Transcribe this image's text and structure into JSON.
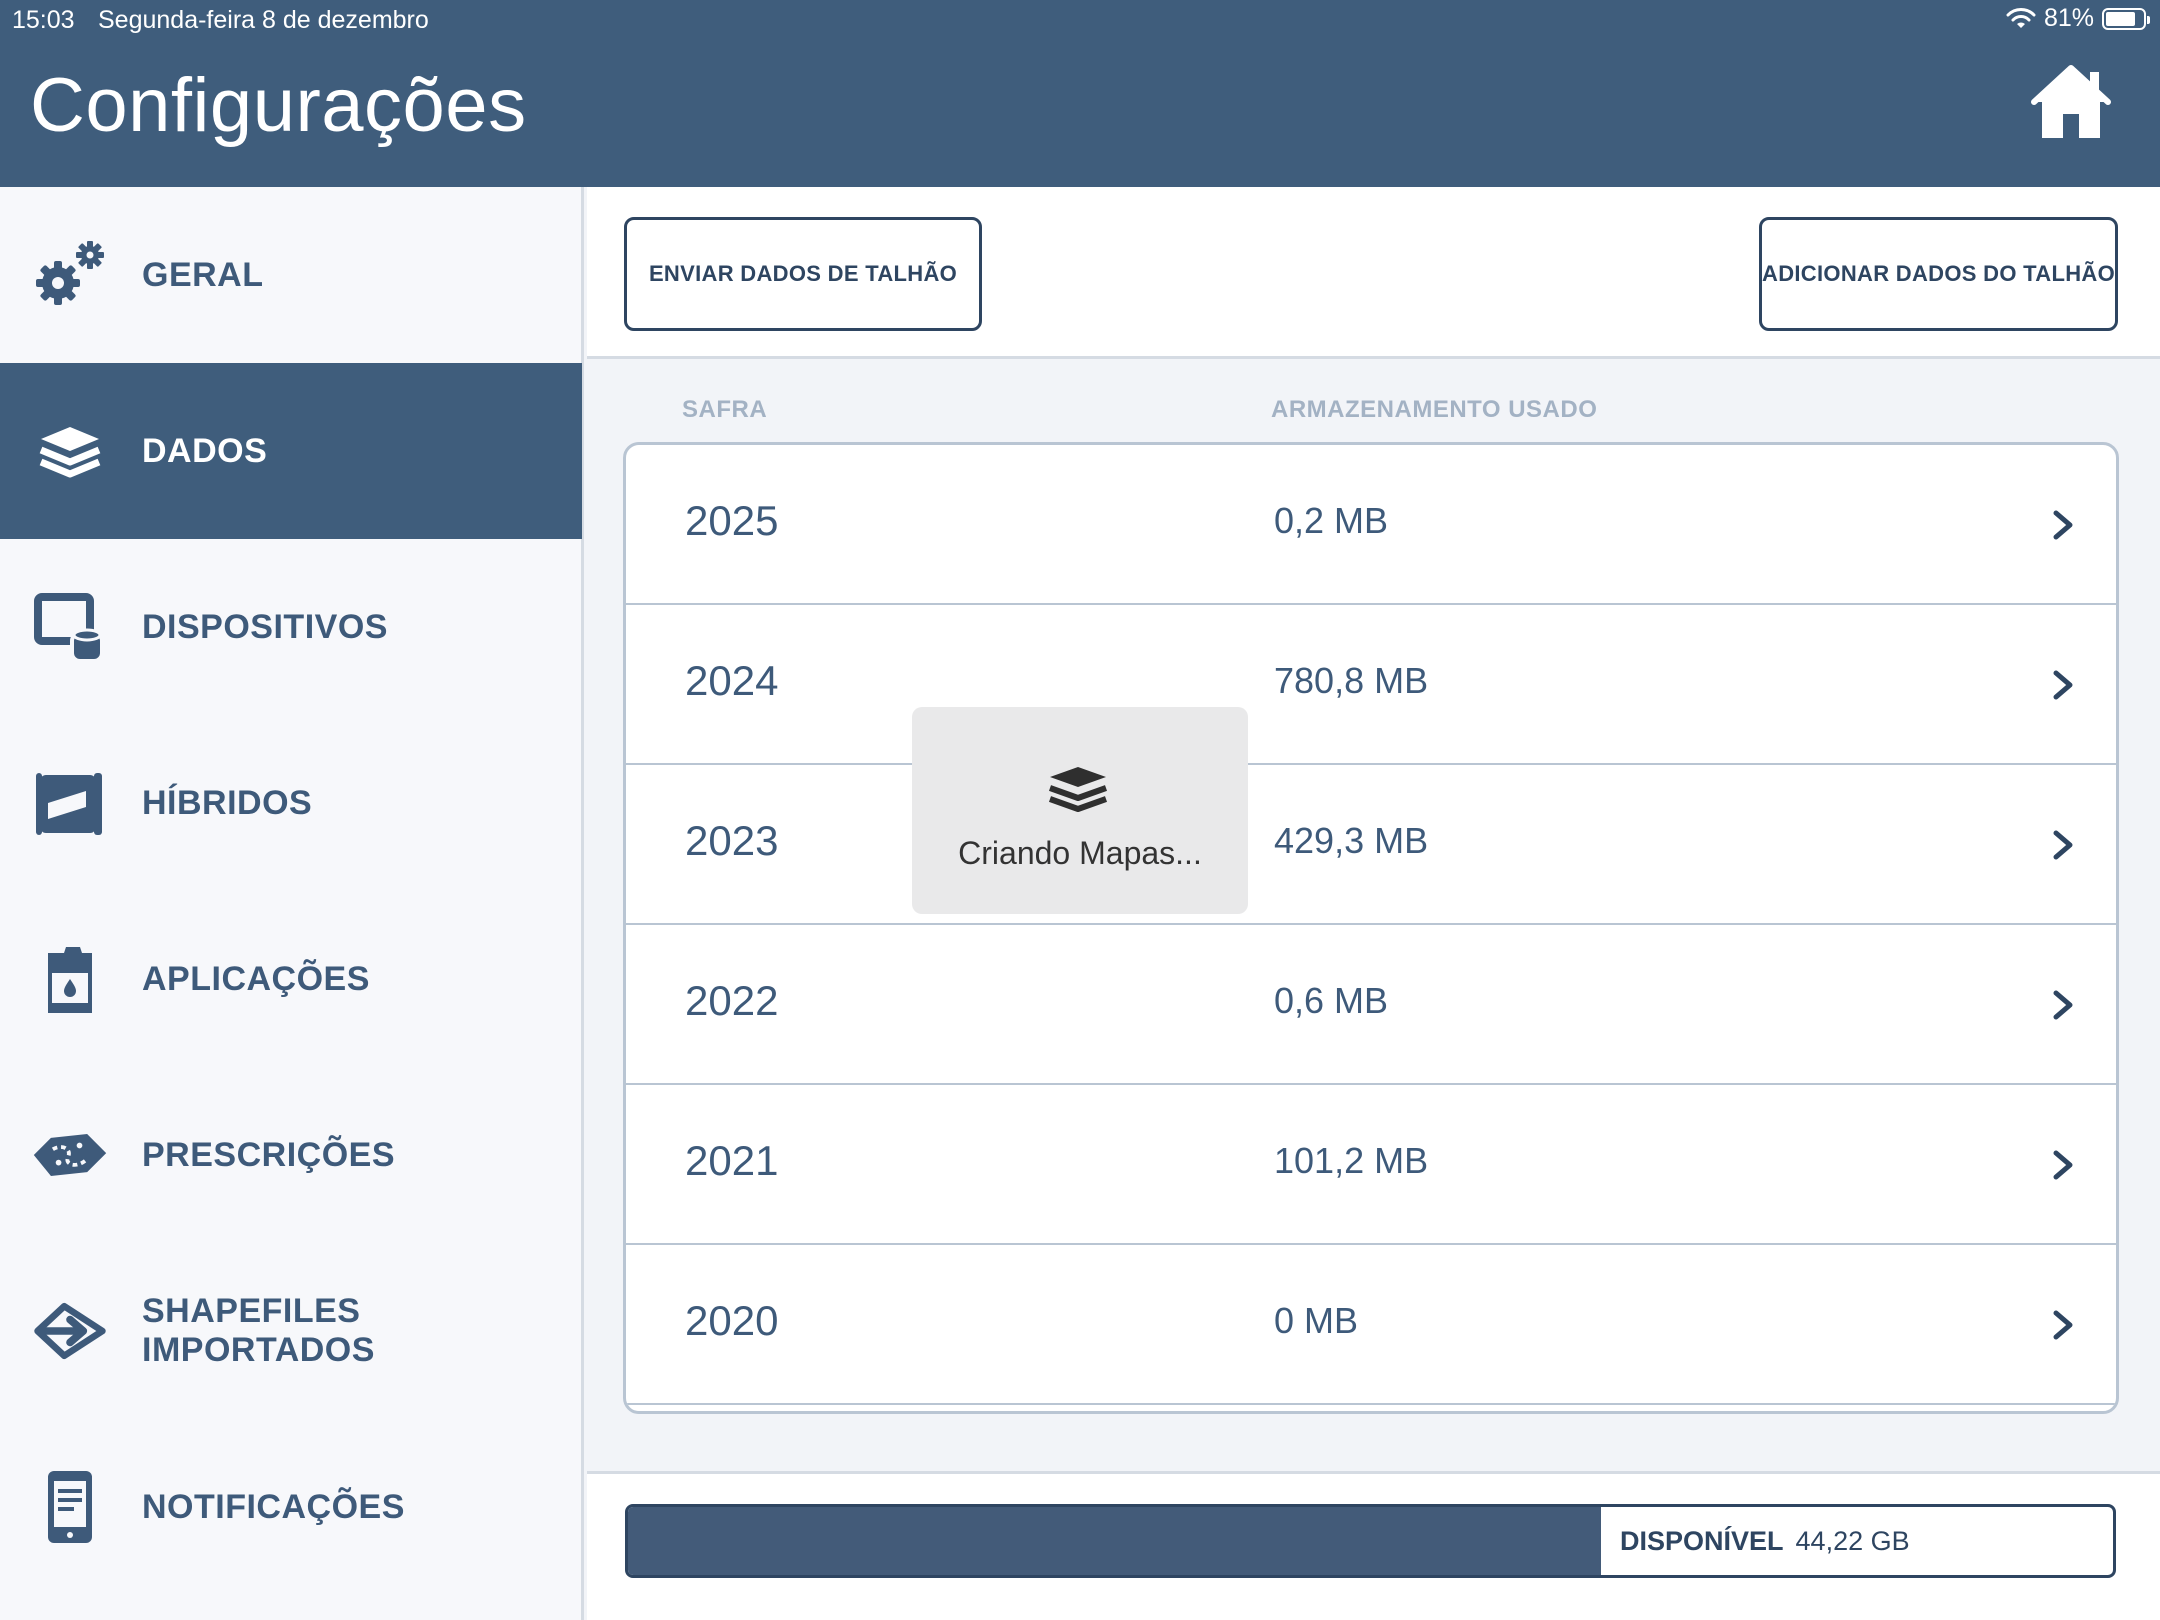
{
  "status": {
    "time": "15:03",
    "date": "Segunda-feira 8 de dezembro",
    "battery": "81%",
    "battery_level": 0.81
  },
  "header": {
    "title": "Configurações",
    "home_icon": "home-icon"
  },
  "sidebar": {
    "items": [
      {
        "label": "GERAL",
        "icon": "gears-icon",
        "active": false
      },
      {
        "label": "DADOS",
        "icon": "layers-icon",
        "active": true
      },
      {
        "label": "DISPOSITIVOS",
        "icon": "devices-icon",
        "active": false
      },
      {
        "label": "HÍBRIDOS",
        "icon": "seed-bag-icon",
        "active": false
      },
      {
        "label": "APLICAÇÕES",
        "icon": "canister-icon",
        "active": false
      },
      {
        "label": "PRESCRIÇÕES",
        "icon": "prescription-map-icon",
        "active": false
      },
      {
        "label": "SHAPEFILES IMPORTADOS",
        "icon": "import-arrow-icon",
        "active": false
      },
      {
        "label": "NOTIFICAÇÕES",
        "icon": "phone-notification-icon",
        "active": false
      }
    ]
  },
  "toolbar": {
    "send_label": "ENVIAR DADOS DE TALHÃO",
    "add_label": "ADICIONAR DADOS DO TALHÃO"
  },
  "table": {
    "headers": {
      "safra": "SAFRA",
      "storage": "ARMAZENAMENTO USADO"
    },
    "rows": [
      {
        "year": "2025",
        "size": "0,2 MB"
      },
      {
        "year": "2024",
        "size": "780,8 MB"
      },
      {
        "year": "2023",
        "size": "429,3 MB"
      },
      {
        "year": "2022",
        "size": "0,6 MB"
      },
      {
        "year": "2021",
        "size": "101,2 MB"
      },
      {
        "year": "2020",
        "size": "0 MB"
      }
    ]
  },
  "toast": {
    "message": "Criando Mapas...",
    "icon": "layers-icon"
  },
  "storage": {
    "label": "DISPONÍVEL",
    "value": "44,22 GB",
    "used_fraction": 0.655
  },
  "colors": {
    "primary": "#3f5d7c",
    "text": "#3e5a7a",
    "border": "#b9c5d3"
  }
}
